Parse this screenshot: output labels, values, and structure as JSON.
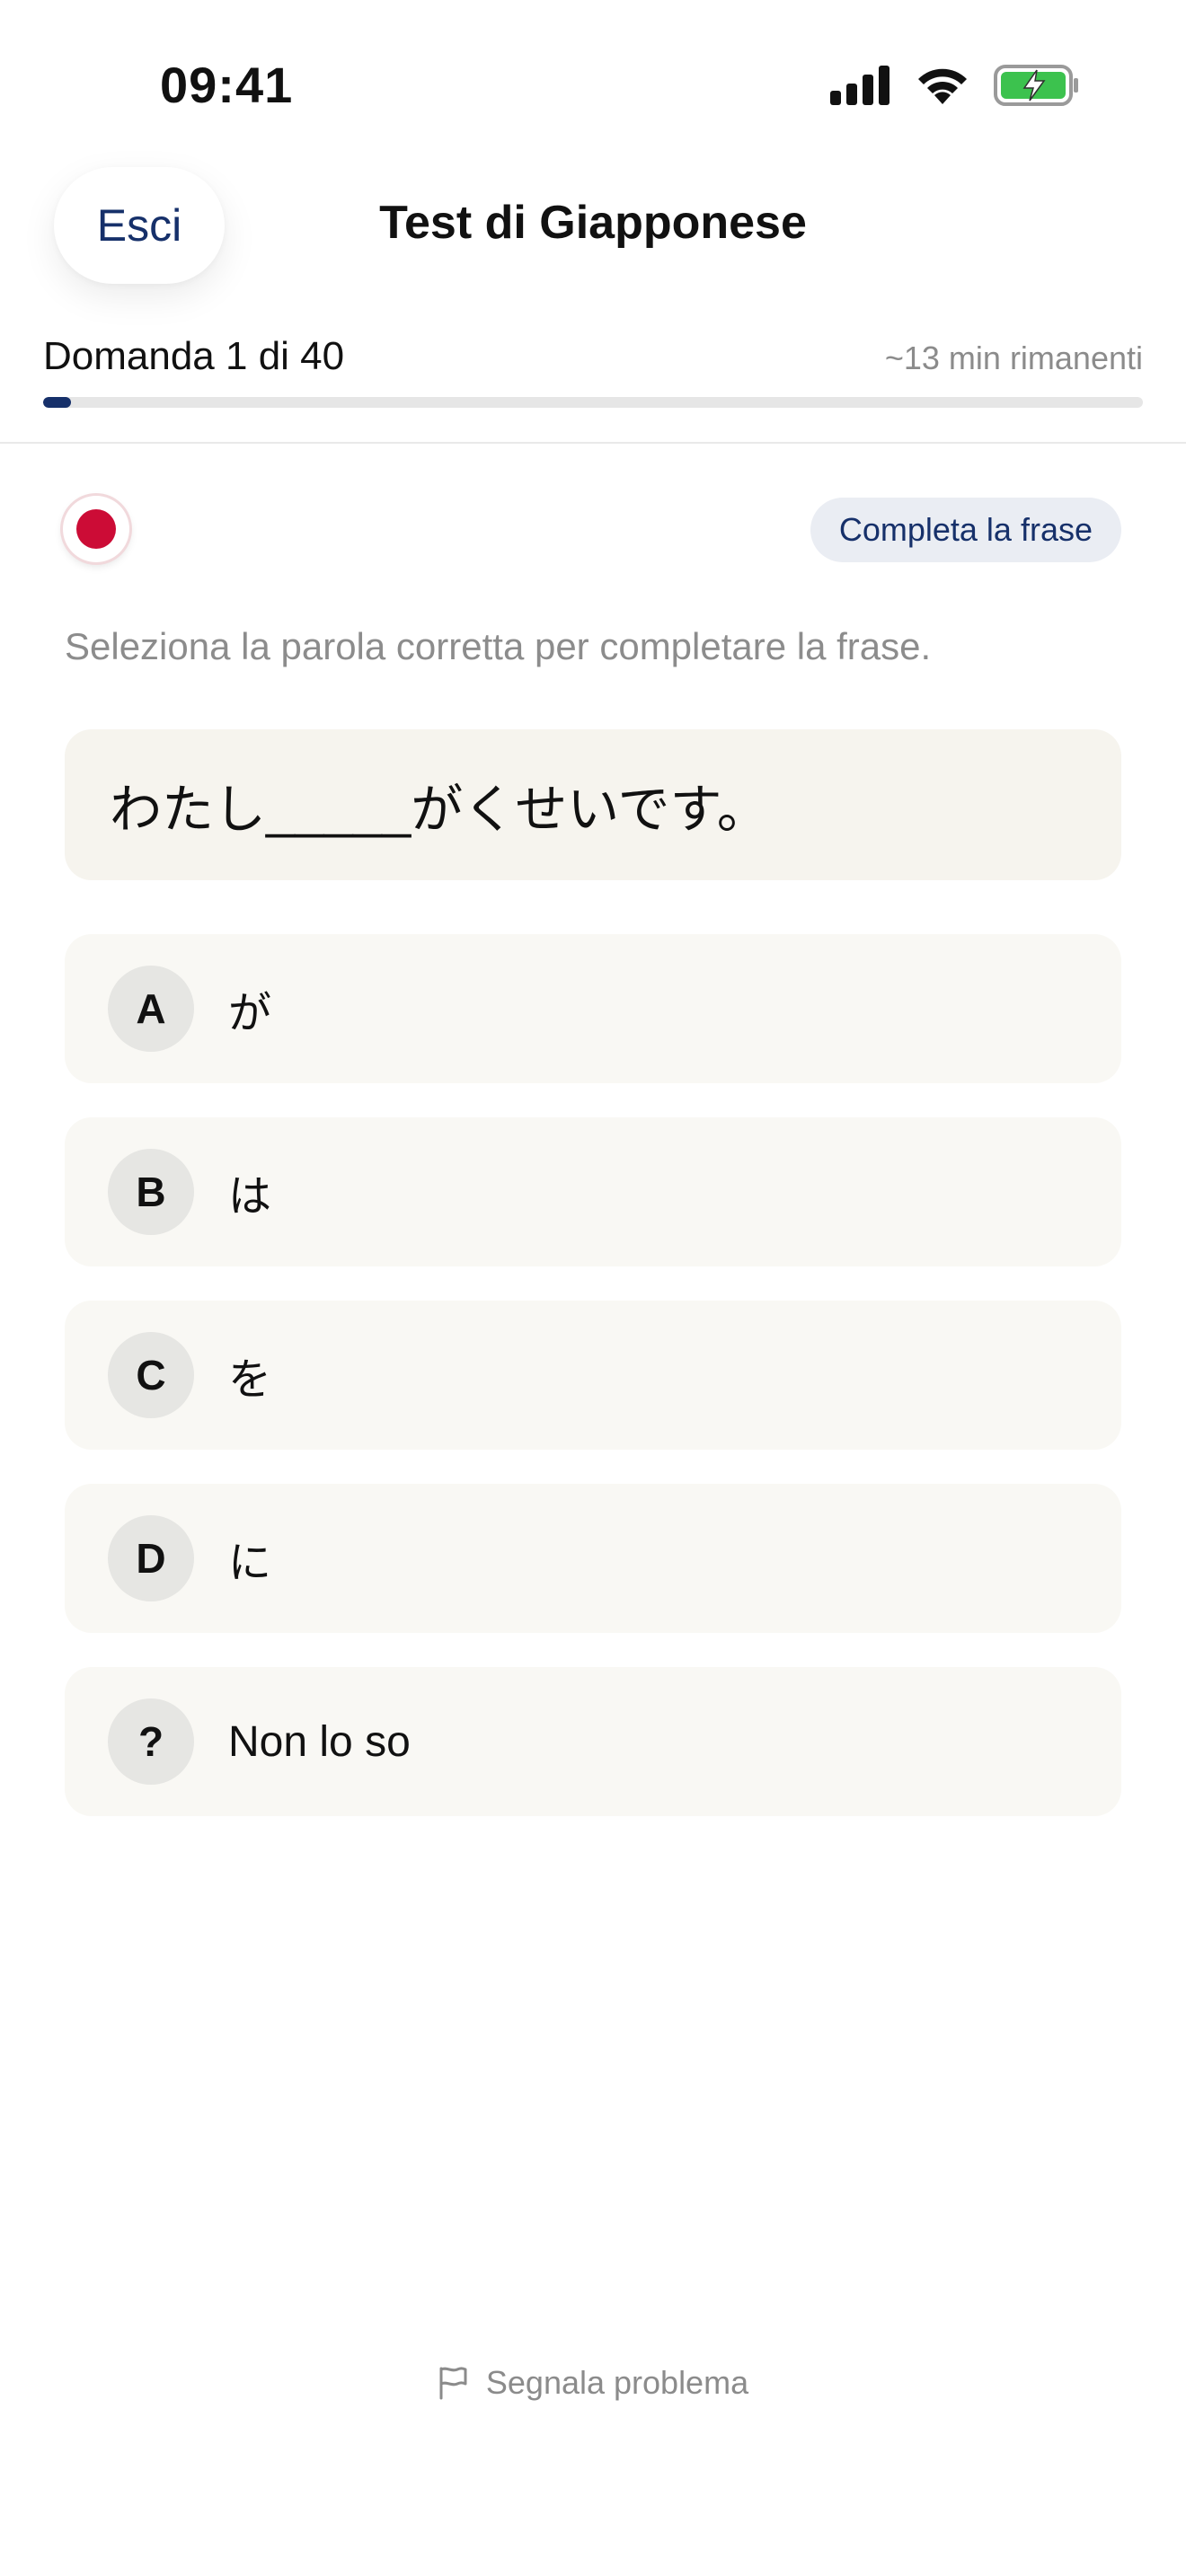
{
  "status_bar": {
    "time": "09:41"
  },
  "header": {
    "exit_label": "Esci",
    "title": "Test di Giapponese"
  },
  "progress": {
    "question_label": "Domanda 1 di 40",
    "time_left": "~13 min rimanenti",
    "fraction": 0.025
  },
  "question": {
    "type_tag": "Completa la frase",
    "instruction": "Seleziona la parola corretta per completare la frase.",
    "sentence": "わたし_____がくせいです。"
  },
  "options": [
    {
      "letter": "A",
      "text": "が"
    },
    {
      "letter": "B",
      "text": "は"
    },
    {
      "letter": "C",
      "text": "を"
    },
    {
      "letter": "D",
      "text": "に"
    },
    {
      "letter": "?",
      "text": "Non lo so"
    }
  ],
  "footer": {
    "report_label": "Segnala problema"
  },
  "colors": {
    "accent": "#16306a",
    "flag_red": "#cc0c36",
    "battery_green": "#3cc24e"
  }
}
